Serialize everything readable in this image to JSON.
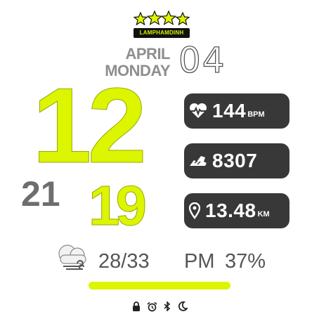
{
  "logo": {
    "brand_text": "LAMPHAMDINH",
    "stars": 4
  },
  "date": {
    "month": "APRIL",
    "weekday": "MONDAY",
    "day": "04"
  },
  "time": {
    "hour": "12",
    "minute": "19",
    "seconds": "21"
  },
  "stats": {
    "heart_rate": {
      "value": "144",
      "unit": "BPM",
      "icon": "heart-rate-icon"
    },
    "steps": {
      "value": "8307",
      "icon": "shoe-icon"
    },
    "distance": {
      "value": "13.48",
      "unit": "KM",
      "icon": "location-pin-icon"
    }
  },
  "weather": {
    "icon": "cloudy-wind-icon",
    "temp_range": "28/33"
  },
  "ampm": "PM",
  "battery": {
    "percent_text": "37%",
    "bar_fill": 1.0
  },
  "status_icons": [
    "lock-icon",
    "alarm-icon",
    "bluetooth-icon",
    "moon-icon"
  ],
  "colors": {
    "accent": "#dcf500",
    "pill_bg": "#383838",
    "gray_text": "#8e8e8e"
  }
}
